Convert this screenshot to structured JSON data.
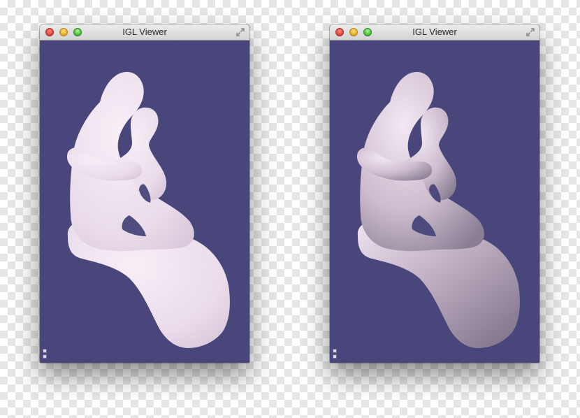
{
  "windows": [
    {
      "title": "IGL Viewer",
      "shading": "smooth"
    },
    {
      "title": "IGL Viewer",
      "shading": "ambient-occlusion"
    }
  ],
  "colors": {
    "viewport_background": "#48467a",
    "model_color": "#efe3ef"
  },
  "icons": {
    "close": "close-button",
    "minimize": "minimize-button",
    "zoom": "zoom-button",
    "fullscreen": "fullscreen-icon"
  }
}
